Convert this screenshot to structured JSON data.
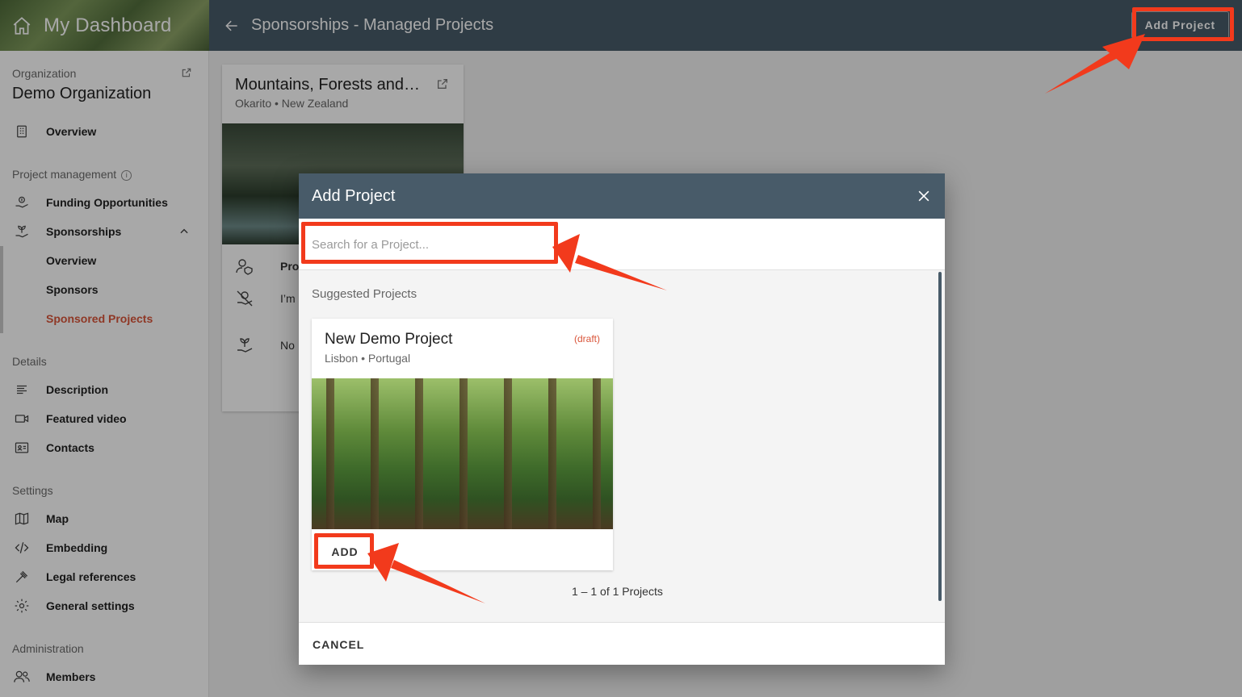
{
  "brand": {
    "title": "My Dashboard"
  },
  "topbar": {
    "title": "Sponsorships - Managed Projects",
    "add_project_label": "Add Project"
  },
  "sidebar": {
    "org_section": "Organization",
    "org_name": "Demo Organization",
    "overview": "Overview",
    "project_mgmt_section": "Project management",
    "funding": "Funding Opportunities",
    "sponsorships": "Sponsorships",
    "sub_overview": "Overview",
    "sponsors": "Sponsors",
    "sponsored_projects": "Sponsored Projects",
    "details_section": "Details",
    "description": "Description",
    "featured_video": "Featured video",
    "contacts": "Contacts",
    "settings_section": "Settings",
    "map": "Map",
    "embedding": "Embedding",
    "legal": "Legal references",
    "general": "General settings",
    "admin_section": "Administration",
    "members": "Members"
  },
  "bg_card": {
    "title": "Mountains, Forests and…",
    "location": "Okarito • New Zealand",
    "row1": "Pro",
    "row2": "I’m",
    "row3": "No"
  },
  "dialog": {
    "title": "Add Project",
    "search_placeholder": "Search for a Project...",
    "suggested_label": "Suggested Projects",
    "pager": "1 – 1 of 1 Projects",
    "cancel_label": "CANCEL"
  },
  "project_card": {
    "title": "New Demo Project",
    "status": "(draft)",
    "location": "Lisbon • Portugal",
    "add_label": "ADD"
  },
  "colors": {
    "header": "#485b69",
    "accent": "#d9553a",
    "annotation": "#f23a1c"
  }
}
